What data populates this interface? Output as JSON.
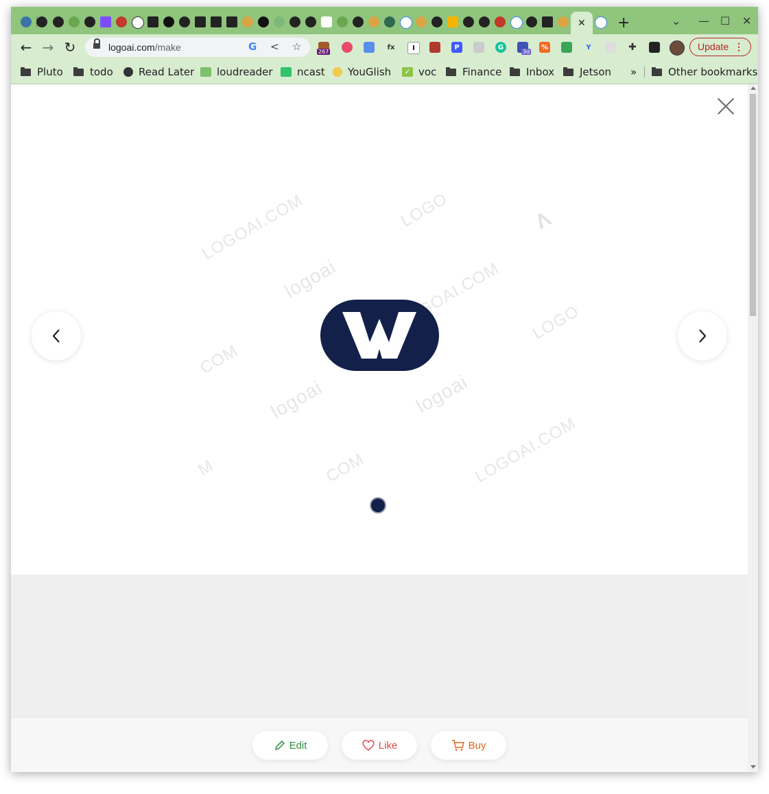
{
  "browser": {
    "address_bar": {
      "domain": "logoai.com",
      "path": "/make"
    },
    "update_button": {
      "label": "Update"
    },
    "extension_badges": {
      "count_badge": "267",
      "three_d_badge": "3d"
    }
  },
  "bookmarks_bar": {
    "items": [
      {
        "label": "Pluto",
        "icon": "folder-icon"
      },
      {
        "label": "todo",
        "icon": "folder-icon"
      },
      {
        "label": "Read Later",
        "icon": "globe-icon"
      },
      {
        "label": "loudreader",
        "icon": "loudreader-icon"
      },
      {
        "label": "ncast",
        "icon": "ncast-icon"
      },
      {
        "label": "YouGlish",
        "icon": "youglish-icon"
      },
      {
        "label": "voc",
        "icon": "check-icon"
      },
      {
        "label": "Finance",
        "icon": "folder-icon"
      },
      {
        "label": "Inbox",
        "icon": "folder-icon"
      },
      {
        "label": "Jetson",
        "icon": "folder-icon"
      }
    ],
    "overflow_label": "»",
    "other_bookmarks": "Other bookmarks"
  },
  "viewer": {
    "logo_letter": "W",
    "watermarks": {
      "site": "LOGOAI.COM",
      "brand": "logoai",
      "fragment_logo": "LOGO",
      "fragment_com": "COM",
      "fragment_m": "M"
    },
    "prev_glyph": "‹",
    "next_glyph": "›",
    "close_glyph": "×"
  },
  "actions": {
    "edit": "Edit",
    "like": "Like",
    "buy": "Buy"
  },
  "colors": {
    "tabstrip": "#8fc57d",
    "toolbar": "#d8ecd0",
    "logo_navy": "#12204a",
    "edit_green": "#2e8b3e",
    "like_red": "#e04848",
    "buy_orange": "#e0661f",
    "update_red": "#b3261e"
  }
}
